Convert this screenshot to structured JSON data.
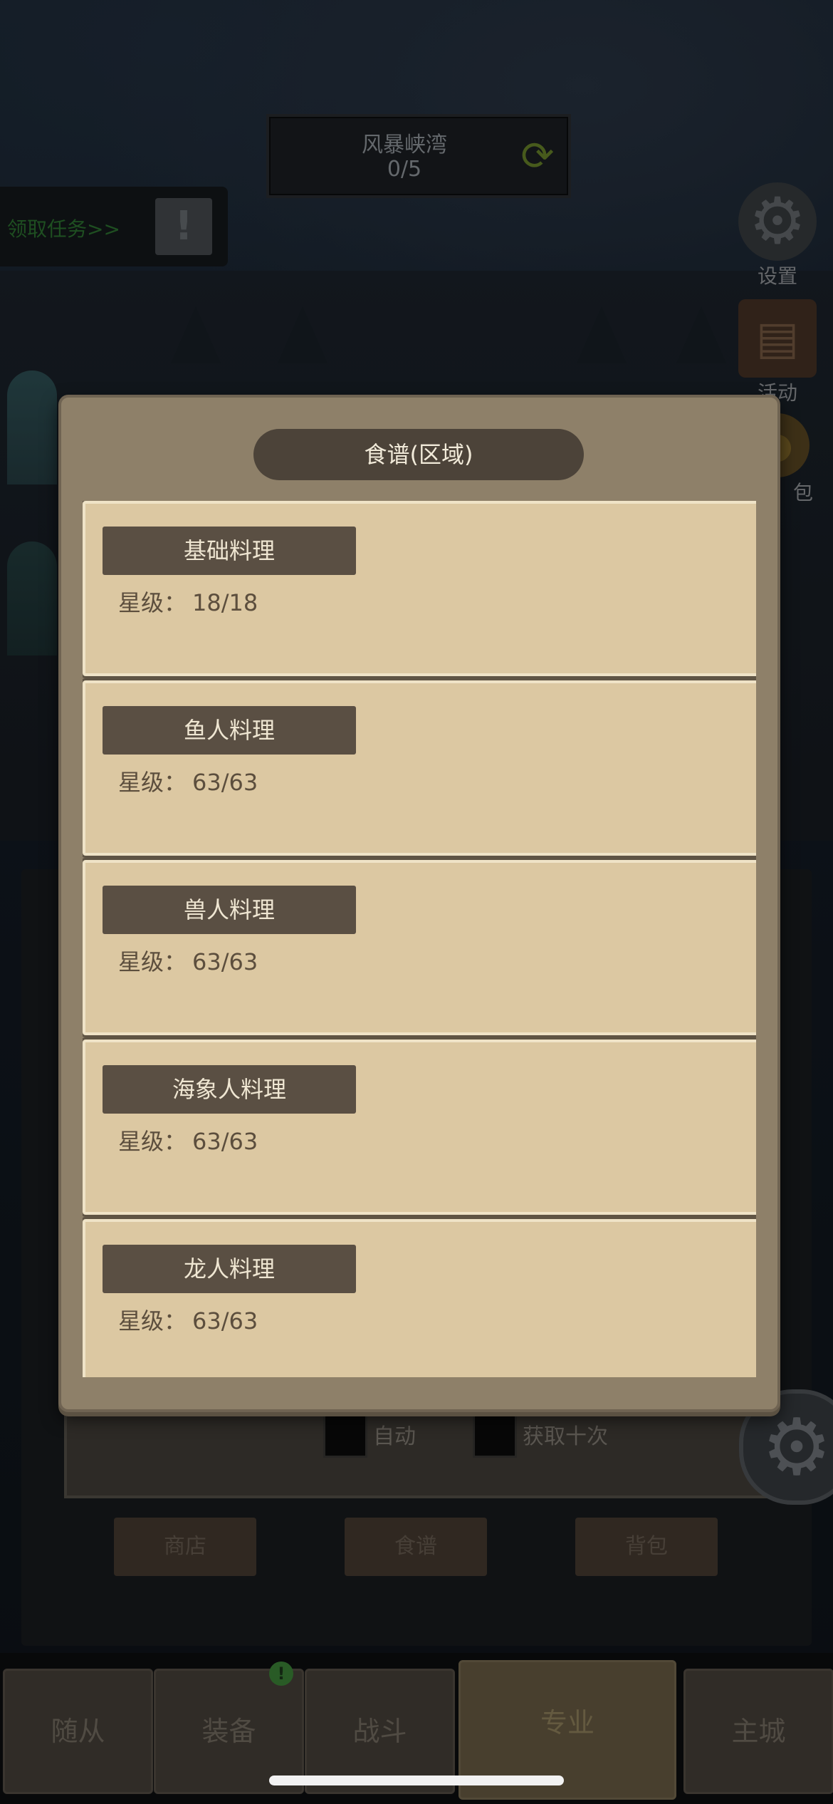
{
  "location": {
    "title": "风暴峡湾",
    "progress": "0/5"
  },
  "task": {
    "label": "领取任务>>"
  },
  "side": {
    "settings": "设置",
    "activity": "活动",
    "bag_partial": "包"
  },
  "modal": {
    "title": "食谱(区域)",
    "stars_label": "星级：",
    "recipes": [
      {
        "name": "基础料理",
        "stars": "18/18"
      },
      {
        "name": "鱼人料理",
        "stars": "63/63"
      },
      {
        "name": "兽人料理",
        "stars": "63/63"
      },
      {
        "name": "海象人料理",
        "stars": "63/63"
      },
      {
        "name": "龙人料理",
        "stars": "63/63"
      }
    ]
  },
  "controls": {
    "auto": "自动",
    "ten": "获取十次"
  },
  "buttons": {
    "shop": "商店",
    "recipe": "食谱",
    "bag": "背包"
  },
  "nav": {
    "tabs": [
      "随从",
      "装备",
      "战斗",
      "专业",
      "主城"
    ],
    "active": "专业",
    "badge": "!"
  }
}
